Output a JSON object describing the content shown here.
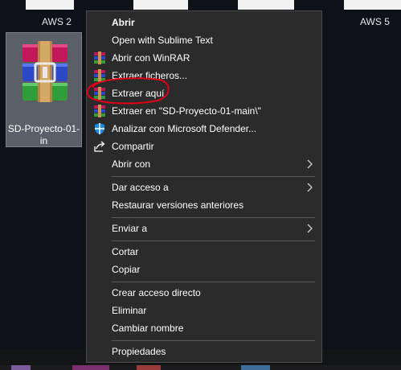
{
  "desktop": {
    "labels": [
      "AWS 2",
      "AWS 5"
    ],
    "file_name": "SD-Proyecto-01-main",
    "file_name_lines": [
      "SD-Proyecto-01-",
      "in"
    ]
  },
  "context_menu": {
    "items": [
      {
        "label": "Abrir"
      },
      {
        "label": "Open with Sublime Text"
      },
      {
        "label": "Abrir con WinRAR"
      },
      {
        "label": "Extraer ficheros..."
      },
      {
        "label": "Extraer aquí"
      },
      {
        "label": "Extraer en \"SD-Proyecto-01-main\\\""
      },
      {
        "label": "Analizar con Microsoft Defender..."
      },
      {
        "label": "Compartir"
      },
      {
        "label": "Abrir con"
      },
      {
        "label": "Dar acceso a"
      },
      {
        "label": "Restaurar versiones anteriores"
      },
      {
        "label": "Enviar a"
      },
      {
        "label": "Cortar"
      },
      {
        "label": "Copiar"
      },
      {
        "label": "Crear acceso directo"
      },
      {
        "label": "Eliminar"
      },
      {
        "label": "Cambiar nombre"
      },
      {
        "label": "Propiedades"
      }
    ]
  },
  "icons": {
    "winrar_item": "winrar-icon",
    "defender": "defender-shield-icon",
    "share": "share-icon",
    "submenu": "chevron-right-icon"
  },
  "colors": {
    "menu_bg": "#2b2b2b",
    "annotation": "#e0001a"
  }
}
